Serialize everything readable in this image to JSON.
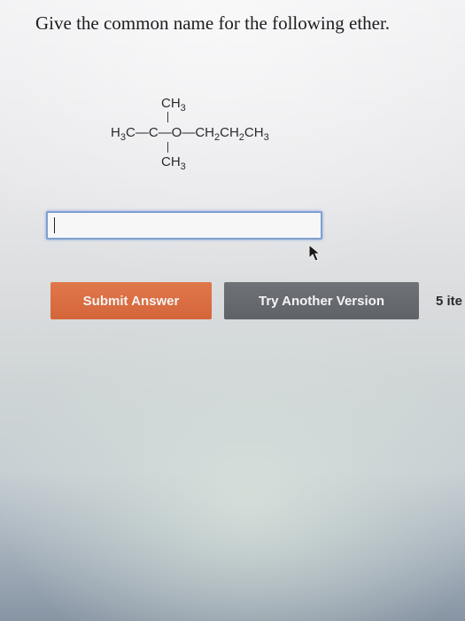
{
  "question": {
    "prompt": "Give the common name for the following ether."
  },
  "structure": {
    "top_group": "CH",
    "top_sub": "3",
    "left_group": "H",
    "left_sub": "3",
    "left_tail": "C",
    "center_atom": "C",
    "oxygen": "O",
    "right_ch_1": "CH",
    "right_sub_1": "2",
    "right_ch_2": "CH",
    "right_sub_2": "2",
    "right_ch_3": "CH",
    "right_sub_3": "3",
    "bottom_group": "CH",
    "bottom_sub": "3"
  },
  "answer": {
    "value": "",
    "placeholder": ""
  },
  "actions": {
    "submit_label": "Submit Answer",
    "try_label": "Try Another Version",
    "items_text": "5 ite"
  },
  "colors": {
    "submit_bg": "#d96c3f",
    "try_bg": "#66696e",
    "input_border": "#7f9fd0"
  }
}
